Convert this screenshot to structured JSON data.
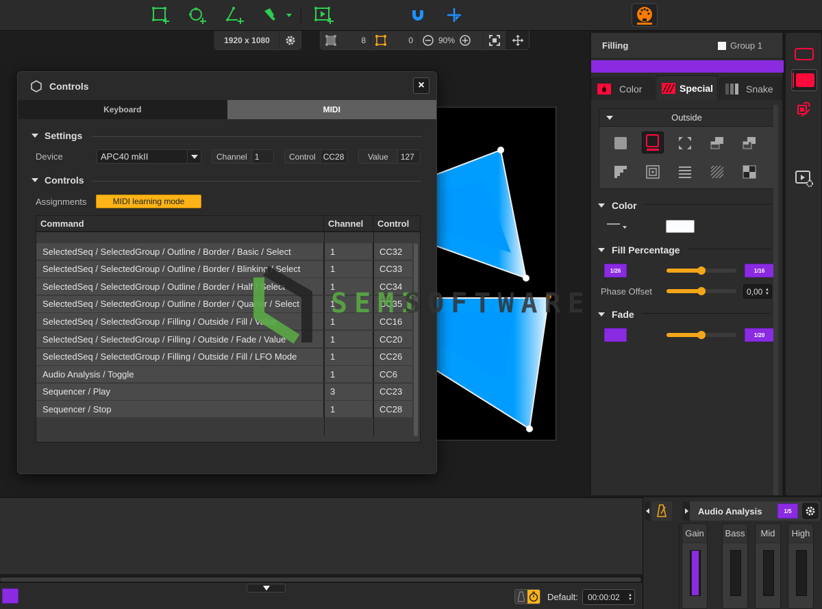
{
  "toolbar": {
    "tools": [
      {
        "name": "add-rectangle-tool",
        "icon": "rect-plus-icon"
      },
      {
        "name": "add-circle-tool",
        "icon": "circle-plus-icon"
      },
      {
        "name": "add-triangle-tool",
        "icon": "triangle-plus-icon"
      },
      {
        "name": "pen-tool",
        "icon": "pen-icon"
      },
      {
        "name": "add-media-tool",
        "icon": "media-plus-icon"
      },
      {
        "name": "magnet-snap",
        "icon": "magnet-icon"
      },
      {
        "name": "crosshair",
        "icon": "crosshair-icon"
      },
      {
        "name": "midi-controls",
        "icon": "midi-icon"
      }
    ],
    "colors": {
      "tool_green": "#2ecc52",
      "snap_blue": "#1e90ff",
      "midi_orange": "#ff7a00"
    }
  },
  "canvas": {
    "resolution": "1920 x 1080",
    "shape_count": "8",
    "selected_count": "0",
    "zoom": "90%"
  },
  "dialog": {
    "title": "Controls",
    "close_label": "×",
    "tabs": [
      {
        "label": "Keyboard",
        "active": false
      },
      {
        "label": "MIDI",
        "active": true
      }
    ],
    "settings": {
      "heading": "Settings",
      "device_label": "Device",
      "device_value": "APC40 mkII",
      "channel_label": "Channel",
      "channel_value": "1",
      "control_label": "Control",
      "control_value": "CC28",
      "value_label": "Value",
      "value_value": "127"
    },
    "controls": {
      "heading": "Controls",
      "assignments_label": "Assignments",
      "learn_button": "MIDI learning mode"
    },
    "table": {
      "headers": [
        "Command",
        "Channel",
        "Control"
      ],
      "rows": [
        {
          "command": "SelectedSeq / SelectedGroup / Outline / Border / Basic / Select",
          "channel": "1",
          "control": "CC32"
        },
        {
          "command": "SelectedSeq / SelectedGroup / Outline / Border / Blinking / Select",
          "channel": "1",
          "control": "CC33"
        },
        {
          "command": "SelectedSeq / SelectedGroup / Outline / Border / Half / Select",
          "channel": "1",
          "control": "CC34"
        },
        {
          "command": "SelectedSeq / SelectedGroup / Outline / Border / Quarter / Select",
          "channel": "1",
          "control": "CC35"
        },
        {
          "command": "SelectedSeq / SelectedGroup / Filling / Outside / Fill / Value",
          "channel": "1",
          "control": "CC16"
        },
        {
          "command": "SelectedSeq / SelectedGroup / Filling / Outside / Fade / Value",
          "channel": "1",
          "control": "CC20"
        },
        {
          "command": "SelectedSeq / SelectedGroup / Filling / Outside / Fill / LFO Mode",
          "channel": "1",
          "control": "CC26"
        },
        {
          "command": "Audio Analysis / Toggle",
          "channel": "1",
          "control": "CC6"
        },
        {
          "command": "Sequencer / Play",
          "channel": "3",
          "control": "CC23"
        },
        {
          "command": "Sequencer / Stop",
          "channel": "1",
          "control": "CC28"
        }
      ]
    }
  },
  "watermark": {
    "part1": "SEMI",
    "part2": "SOFTWARES"
  },
  "panel": {
    "title": "Filling",
    "group_label": "Group 1",
    "tabs": [
      {
        "label": "Color",
        "active": false
      },
      {
        "label": "Special",
        "active": true
      },
      {
        "label": "Snake",
        "active": false
      }
    ],
    "outside": {
      "heading": "Outside",
      "modes": [
        "solid",
        "outline",
        "corners",
        "overlap-left",
        "overlap-right",
        "stairs",
        "concentric",
        "lines",
        "diagonal-stripes",
        "checker"
      ],
      "selected_mode": "outline"
    },
    "color": {
      "heading": "Color",
      "swatch": "#ffffff"
    },
    "fill_percentage": {
      "heading": "Fill Percentage",
      "left_chip": "1/26",
      "right_chip": "1/16",
      "fill_value": 0.5,
      "phase_label": "Phase Offset",
      "phase_value_num": 0.5,
      "phase_value": "0,00"
    },
    "fade": {
      "heading": "Fade",
      "left_chip": "",
      "right_chip": "1/20",
      "fade_value": 0.5
    },
    "accent": "#8a2be2",
    "slider_color": "#f4a61a"
  },
  "audio": {
    "title": "Audio Analysis",
    "chip": "1/5",
    "channels": [
      {
        "name": "Gain",
        "level": 1.0
      },
      {
        "name": "Bass",
        "level": 0
      },
      {
        "name": "Mid",
        "level": 0
      },
      {
        "name": "High",
        "level": 0
      }
    ]
  },
  "bottom": {
    "default_label": "Default:",
    "default_time": "00:00:02"
  }
}
